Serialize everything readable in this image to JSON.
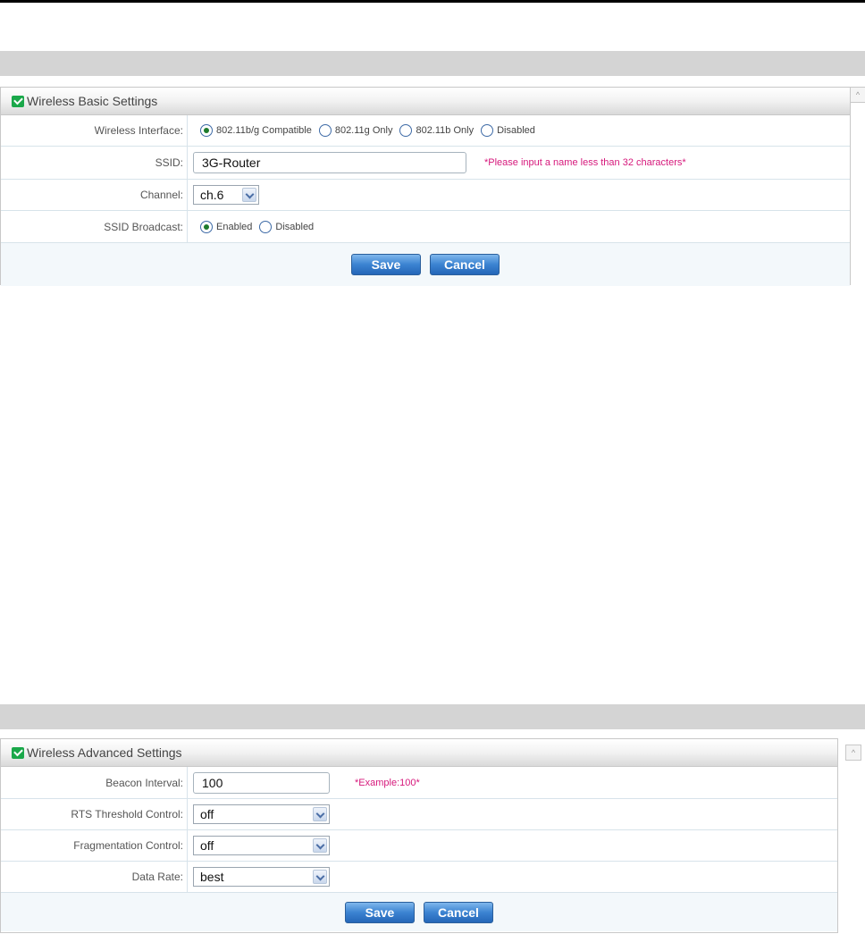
{
  "basic": {
    "title": "Wireless Basic Settings",
    "interface_label": "Wireless Interface:",
    "interface_options": [
      "802.11b/g Compatible",
      "802.11g Only",
      "802.11b Only",
      "Disabled"
    ],
    "interface_selected": "802.11b/g Compatible",
    "ssid_label": "SSID:",
    "ssid_value": "3G-Router",
    "ssid_hint": "*Please input a name less than 32 characters*",
    "channel_label": "Channel:",
    "channel_value": "ch.6",
    "broadcast_label": "SSID Broadcast:",
    "broadcast_options": [
      "Enabled",
      "Disabled"
    ],
    "broadcast_selected": "Enabled",
    "save": "Save",
    "cancel": "Cancel"
  },
  "advanced": {
    "title": "Wireless Advanced Settings",
    "beacon_label": "Beacon Interval:",
    "beacon_value": "100",
    "beacon_hint": "*Example:100*",
    "rts_label": "RTS Threshold Control:",
    "rts_value": "off",
    "frag_label": "Fragmentation Control:",
    "frag_value": "off",
    "rate_label": "Data Rate:",
    "rate_value": "best",
    "save": "Save",
    "cancel": "Cancel"
  },
  "colors": {
    "hint": "#d6187b",
    "button": "#3b83d1",
    "header_icon": "#1aa84a"
  }
}
